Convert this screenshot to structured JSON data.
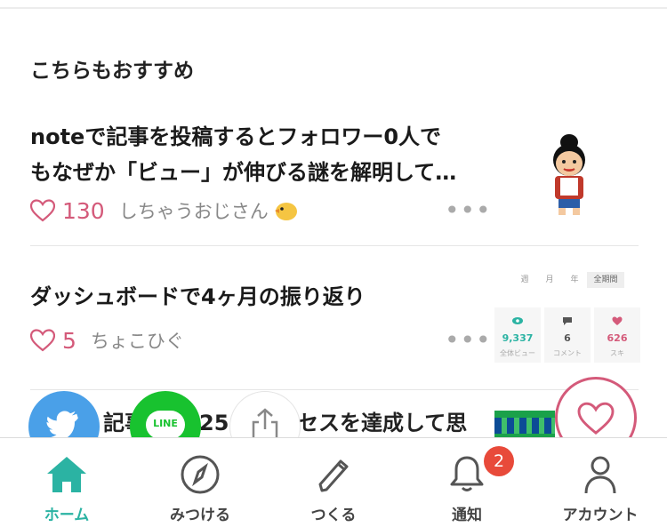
{
  "section": {
    "title": "こちらもおすすめ"
  },
  "articles": [
    {
      "title_line1": "noteで記事を投稿するとフォロワー0人で",
      "title_line2": "もなぜか「ビュー」が伸びる謎を解明して…",
      "likes": "130",
      "author": "しちゃうおじさん",
      "more": "•••"
    },
    {
      "title_line1": "ダッシュボードで4ヶ月の振り返り",
      "likes": "5",
      "author": "ちょこひぐ",
      "more": "•••"
    },
    {
      "title_partial_a": "記事",
      "title_partial_b": "25",
      "title_partial_c": "セスを達成して思"
    }
  ],
  "dashboard_thumb": {
    "tabs": [
      "週",
      "月",
      "年",
      "全期間"
    ],
    "cards": [
      {
        "value": "9,337",
        "label": "全体ビュー",
        "color": "#2bb3a3"
      },
      {
        "value": "6",
        "label": "コメント",
        "color": "#555555"
      },
      {
        "value": "626",
        "label": "スキ",
        "color": "#d45a7a"
      }
    ]
  },
  "share": {
    "line_label": "LINE"
  },
  "nav": {
    "items": [
      {
        "label": "ホーム",
        "icon": "home-icon",
        "active": true
      },
      {
        "label": "みつける",
        "icon": "compass-icon"
      },
      {
        "label": "つくる",
        "icon": "pencil-icon"
      },
      {
        "label": "通知",
        "icon": "bell-icon"
      },
      {
        "label": "アカウント",
        "icon": "person-icon"
      }
    ],
    "notification_badge": "2"
  },
  "colors": {
    "accent": "#2bb3a3",
    "like": "#d45a7a",
    "badge": "#e84a3a"
  }
}
